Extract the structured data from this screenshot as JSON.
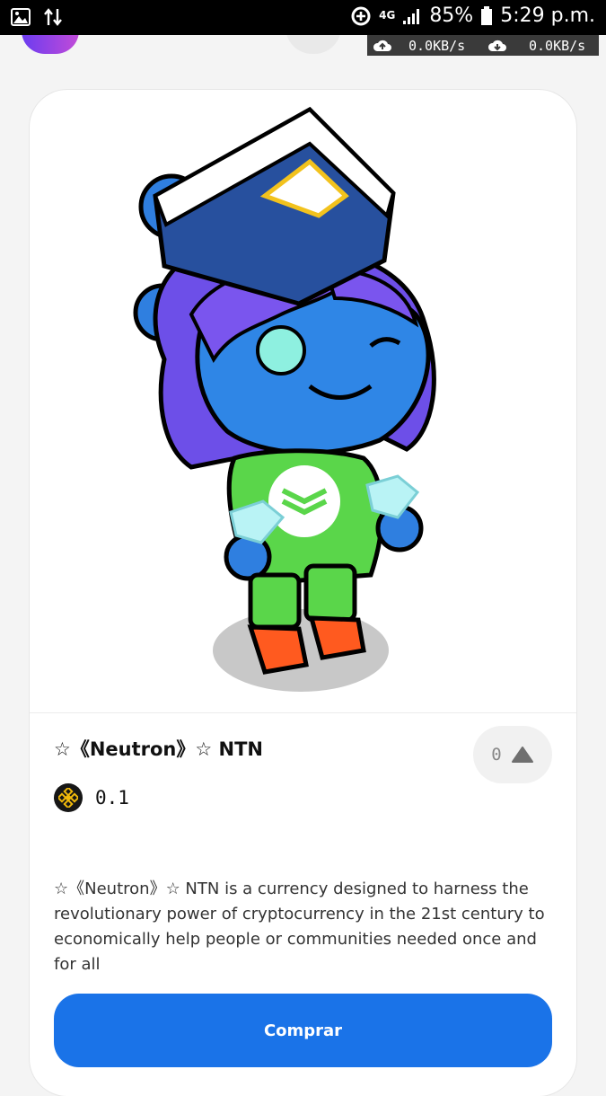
{
  "status_bar": {
    "battery": "85%",
    "time": "5:29 p.m.",
    "network": "4G",
    "upload_speed": "0.0KB/s",
    "download_speed": "0.0KB/s"
  },
  "nft": {
    "title": "☆《Neutron》☆ NTN",
    "votes": "0",
    "price": "0.1",
    "description": "☆《Neutron》☆ NTN is a currency designed to harness the revolutionary power of cryptocurrency in the 21st century to economically help people or communities needed once and for all",
    "buy_label": "Comprar",
    "currency_icon": "bnb-icon",
    "accent_color": "#1a73e8"
  }
}
